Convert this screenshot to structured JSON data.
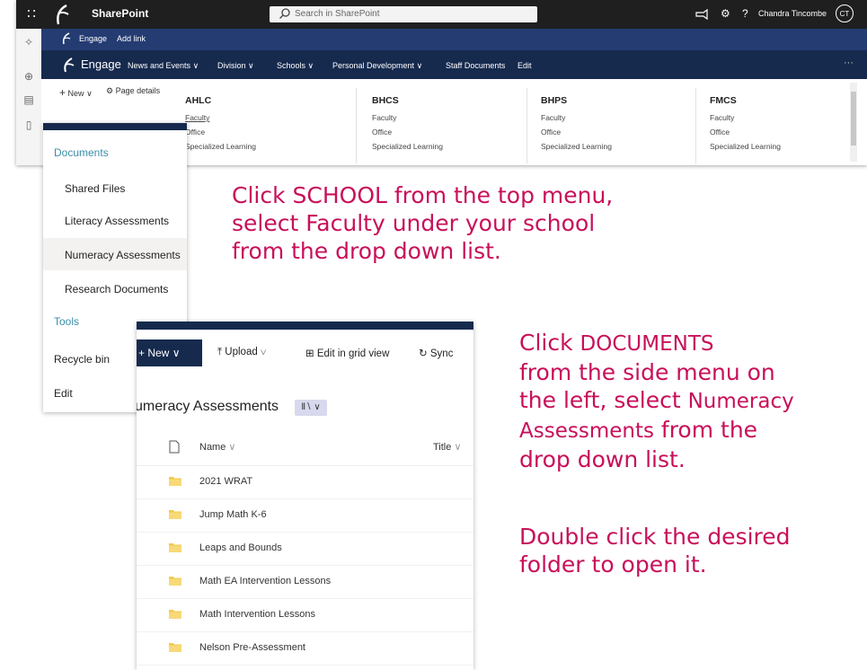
{
  "suite": {
    "app_title": "SharePoint",
    "search_placeholder": "Search in SharePoint",
    "user_name": "Chandra Tincombe",
    "user_initials": "CT",
    "help_glyph": "?",
    "icons": [
      "waffle-icon",
      "feedback-icon",
      "settings-icon",
      "help-icon"
    ]
  },
  "hub": {
    "name": "Engage",
    "add_link": "Add link"
  },
  "nav": {
    "site_name": "Engage",
    "items": [
      "News and Events",
      "Division",
      "Schools",
      "Personal Development",
      "Staff Documents",
      "Edit"
    ],
    "ellipsis": "···"
  },
  "command_bar": {
    "new_label": "New",
    "page_details": "Page details"
  },
  "schools": [
    {
      "name": "AHLC",
      "links": [
        "Faculty",
        "Office",
        "Specialized Learning"
      ]
    },
    {
      "name": "BHCS",
      "links": [
        "Faculty",
        "Office",
        "Specialized Learning"
      ]
    },
    {
      "name": "BHPS",
      "links": [
        "Faculty",
        "Office",
        "Specialized Learning"
      ]
    },
    {
      "name": "FMCS",
      "links": [
        "Faculty",
        "Office",
        "Specialized Learning"
      ]
    }
  ],
  "side_menu": {
    "documents_header": "Documents",
    "document_items": [
      "Shared Files",
      "Literacy Assessments",
      "Numeracy Assessments",
      "Research Documents"
    ],
    "tools_header": "Tools",
    "tool_items": [
      "Recycle bin",
      "Edit"
    ]
  },
  "library": {
    "new_label": "+ New",
    "upload_label": "Upload",
    "grid_label": "Edit in grid view",
    "sync_label": "Sync",
    "title": "umeracy Assessments",
    "col_name": "Name",
    "col_title": "Title",
    "folders": [
      "2021 WRAT",
      "Jump Math K-6",
      "Leaps and Bounds",
      "Math EA Intervention Lessons",
      "Math Intervention Lessons",
      "Nelson Pre-Assessment"
    ]
  },
  "instructions": {
    "step1": [
      "Click SCHOOL from the top menu,",
      "select Faculty under your school",
      "from the drop down list."
    ],
    "step2_line1_a": "Click",
    "step2_line1_b": "DOCUMENTS",
    "step2_line2": "from the side menu on",
    "step2_line3_a": "the left, select",
    "step2_line3_b": "Numeracy",
    "step2_line4_a": "Assessments",
    "step2_line4_b": "from the",
    "step2_line5": "drop down list.",
    "step3": [
      "Double click the desired",
      "folder to open it."
    ]
  },
  "colors": {
    "accent_text": "#c8105a",
    "nav_dark": "#162a4e",
    "hub_blue": "#243c72",
    "folder": "#f2c94c"
  }
}
